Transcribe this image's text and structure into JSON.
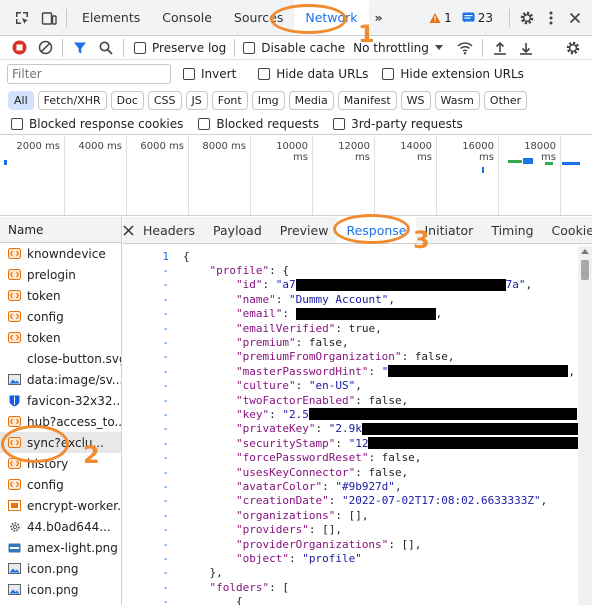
{
  "toolbar": {
    "tabs": [
      "Elements",
      "Console",
      "Sources",
      "Network"
    ],
    "more": "»",
    "warn_count": "1",
    "msg_count": "23"
  },
  "controls": {
    "preserve_log": "Preserve log",
    "disable_cache": "Disable cache",
    "throttling": "No throttling"
  },
  "filter": {
    "placeholder": "Filter",
    "invert": "Invert",
    "hide_data": "Hide data URLs",
    "hide_ext": "Hide extension URLs"
  },
  "types": [
    "All",
    "Fetch/XHR",
    "Doc",
    "CSS",
    "JS",
    "Font",
    "Img",
    "Media",
    "Manifest",
    "WS",
    "Wasm",
    "Other"
  ],
  "blocked": {
    "cookies": "Blocked response cookies",
    "requests": "Blocked requests",
    "third_party": "3rd-party requests"
  },
  "timeline": {
    "ticks": [
      "2000 ms",
      "4000 ms",
      "6000 ms",
      "8000 ms",
      "10000 ms",
      "12000 ms",
      "14000 ms",
      "16000 ms",
      "18000 ms"
    ]
  },
  "names": {
    "header": "Name",
    "items": [
      "knowndevice",
      "prelogin",
      "token",
      "config",
      "token",
      "close-button.svg",
      "data:image/sv...",
      "favicon-32x32...",
      "hub?access_to...",
      "sync?exclu...",
      "history",
      "config",
      "encrypt-worker...",
      "44.b0ad644...",
      "amex-light.png",
      "icon.png",
      "icon.png"
    ]
  },
  "detail_tabs": [
    "Headers",
    "Payload",
    "Preview",
    "Response",
    "Initiator",
    "Timing",
    "Cookies"
  ],
  "response": {
    "line_numbers": [
      "1",
      "-",
      "-",
      "-",
      "-",
      "-",
      "-",
      "-",
      "-",
      "-",
      "-",
      "-",
      "-",
      "-",
      "-",
      "-",
      "-",
      "-",
      "-",
      "-",
      "-",
      "-",
      "-",
      "-",
      "-"
    ],
    "lines": [
      {
        "indent": "",
        "parts": [
          [
            "p",
            "{"
          ]
        ]
      },
      {
        "indent": "    ",
        "parts": [
          [
            "k",
            "\"profile\""
          ],
          [
            "p",
            ": {"
          ]
        ]
      },
      {
        "indent": "        ",
        "parts": [
          [
            "k",
            "\"id\""
          ],
          [
            "p",
            ": "
          ],
          [
            "s",
            "\"a7"
          ],
          [
            "r",
            "210"
          ],
          [
            "s",
            "7a\""
          ],
          [
            "p",
            ","
          ]
        ]
      },
      {
        "indent": "        ",
        "parts": [
          [
            "k",
            "\"name\""
          ],
          [
            "p",
            ": "
          ],
          [
            "s",
            "\"Dummy Account\""
          ],
          [
            "p",
            ","
          ]
        ]
      },
      {
        "indent": "        ",
        "parts": [
          [
            "k",
            "\"email\""
          ],
          [
            "p",
            ": "
          ],
          [
            "r",
            "140"
          ],
          [
            "p",
            ","
          ]
        ]
      },
      {
        "indent": "        ",
        "parts": [
          [
            "k",
            "\"emailVerified\""
          ],
          [
            "p",
            ": true,"
          ]
        ]
      },
      {
        "indent": "        ",
        "parts": [
          [
            "k",
            "\"premium\""
          ],
          [
            "p",
            ": false,"
          ]
        ]
      },
      {
        "indent": "        ",
        "parts": [
          [
            "k",
            "\"premiumFromOrganization\""
          ],
          [
            "p",
            ": false,"
          ]
        ]
      },
      {
        "indent": "        ",
        "parts": [
          [
            "k",
            "\"masterPasswordHint\""
          ],
          [
            "p",
            ": "
          ],
          [
            "s",
            "\""
          ],
          [
            "r",
            "180"
          ],
          [
            "p",
            ","
          ]
        ]
      },
      {
        "indent": "        ",
        "parts": [
          [
            "k",
            "\"culture\""
          ],
          [
            "p",
            ": "
          ],
          [
            "s",
            "\"en-US\""
          ],
          [
            "p",
            ","
          ]
        ]
      },
      {
        "indent": "        ",
        "parts": [
          [
            "k",
            "\"twoFactorEnabled\""
          ],
          [
            "p",
            ": false,"
          ]
        ]
      },
      {
        "indent": "        ",
        "parts": [
          [
            "k",
            "\"key\""
          ],
          [
            "p",
            ": "
          ],
          [
            "s",
            "\"2.5"
          ],
          [
            "r",
            "268"
          ]
        ]
      },
      {
        "indent": "        ",
        "parts": [
          [
            "k",
            "\"privateKey\""
          ],
          [
            "p",
            ": "
          ],
          [
            "s",
            "\"2.9k"
          ],
          [
            "r",
            "236"
          ]
        ]
      },
      {
        "indent": "        ",
        "parts": [
          [
            "k",
            "\"securityStamp\""
          ],
          [
            "p",
            ": "
          ],
          [
            "s",
            "\"12"
          ],
          [
            "r",
            "224"
          ]
        ]
      },
      {
        "indent": "        ",
        "parts": [
          [
            "k",
            "\"forcePasswordReset\""
          ],
          [
            "p",
            ": false,"
          ]
        ]
      },
      {
        "indent": "        ",
        "parts": [
          [
            "k",
            "\"usesKeyConnector\""
          ],
          [
            "p",
            ": false,"
          ]
        ]
      },
      {
        "indent": "        ",
        "parts": [
          [
            "k",
            "\"avatarColor\""
          ],
          [
            "p",
            ": "
          ],
          [
            "s",
            "\"#9b927d\""
          ],
          [
            "p",
            ","
          ]
        ]
      },
      {
        "indent": "        ",
        "parts": [
          [
            "k",
            "\"creationDate\""
          ],
          [
            "p",
            ": "
          ],
          [
            "s",
            "\"2022-07-02T17:08:02.6633333Z\""
          ],
          [
            "p",
            ","
          ]
        ]
      },
      {
        "indent": "        ",
        "parts": [
          [
            "k",
            "\"organizations\""
          ],
          [
            "p",
            ": [],"
          ]
        ]
      },
      {
        "indent": "        ",
        "parts": [
          [
            "k",
            "\"providers\""
          ],
          [
            "p",
            ": [],"
          ]
        ]
      },
      {
        "indent": "        ",
        "parts": [
          [
            "k",
            "\"providerOrganizations\""
          ],
          [
            "p",
            ": [],"
          ]
        ]
      },
      {
        "indent": "        ",
        "parts": [
          [
            "k",
            "\"object\""
          ],
          [
            "p",
            ": "
          ],
          [
            "s",
            "\"profile\""
          ]
        ]
      },
      {
        "indent": "    ",
        "parts": [
          [
            "p",
            "},"
          ]
        ]
      },
      {
        "indent": "    ",
        "parts": [
          [
            "k",
            "\"folders\""
          ],
          [
            "p",
            ": ["
          ]
        ]
      },
      {
        "indent": "        ",
        "parts": [
          [
            "p",
            "{"
          ]
        ]
      }
    ]
  },
  "annotations": [
    "1",
    "2",
    "3"
  ],
  "colors": {
    "accent": "#1a73e8",
    "annotation": "#f28a30",
    "record_red": "#d93025"
  }
}
